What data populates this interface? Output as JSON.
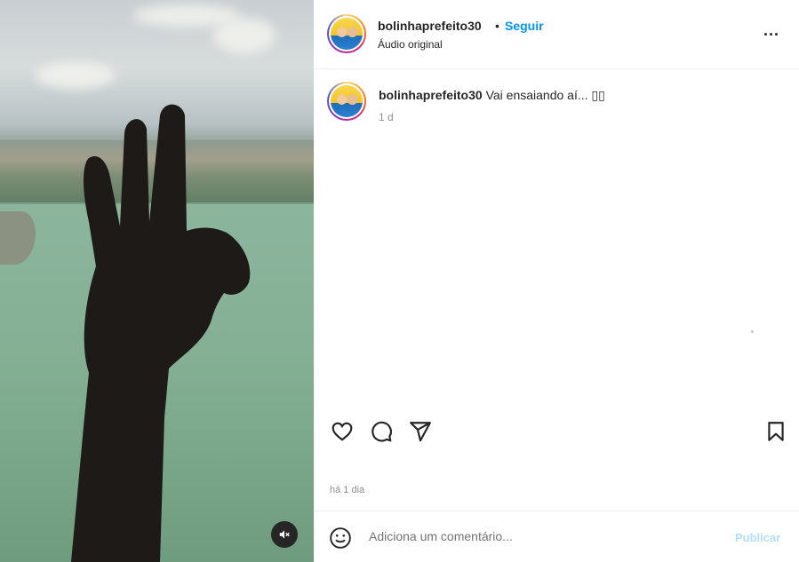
{
  "post": {
    "username": "bolinhaprefeito30",
    "separator": "•",
    "follow_label": "Seguir",
    "audio_label": "Áudio original",
    "more_label": "..."
  },
  "caption": {
    "username": "bolinhaprefeito30",
    "text": "Vai ensaiando aí... ▯▯",
    "time": "1 d"
  },
  "actions": {
    "like_icon": "heart-icon",
    "comment_icon": "comment-icon",
    "share_icon": "paper-plane-icon",
    "save_icon": "bookmark-icon"
  },
  "date_label": "há 1 dia",
  "comment": {
    "placeholder": "Adiciona um comentário...",
    "publish_label": "Publicar"
  },
  "colors": {
    "accent": "#0095f6",
    "publish_disabled": "#b2dffc",
    "muted_text": "#8e8e8e"
  }
}
